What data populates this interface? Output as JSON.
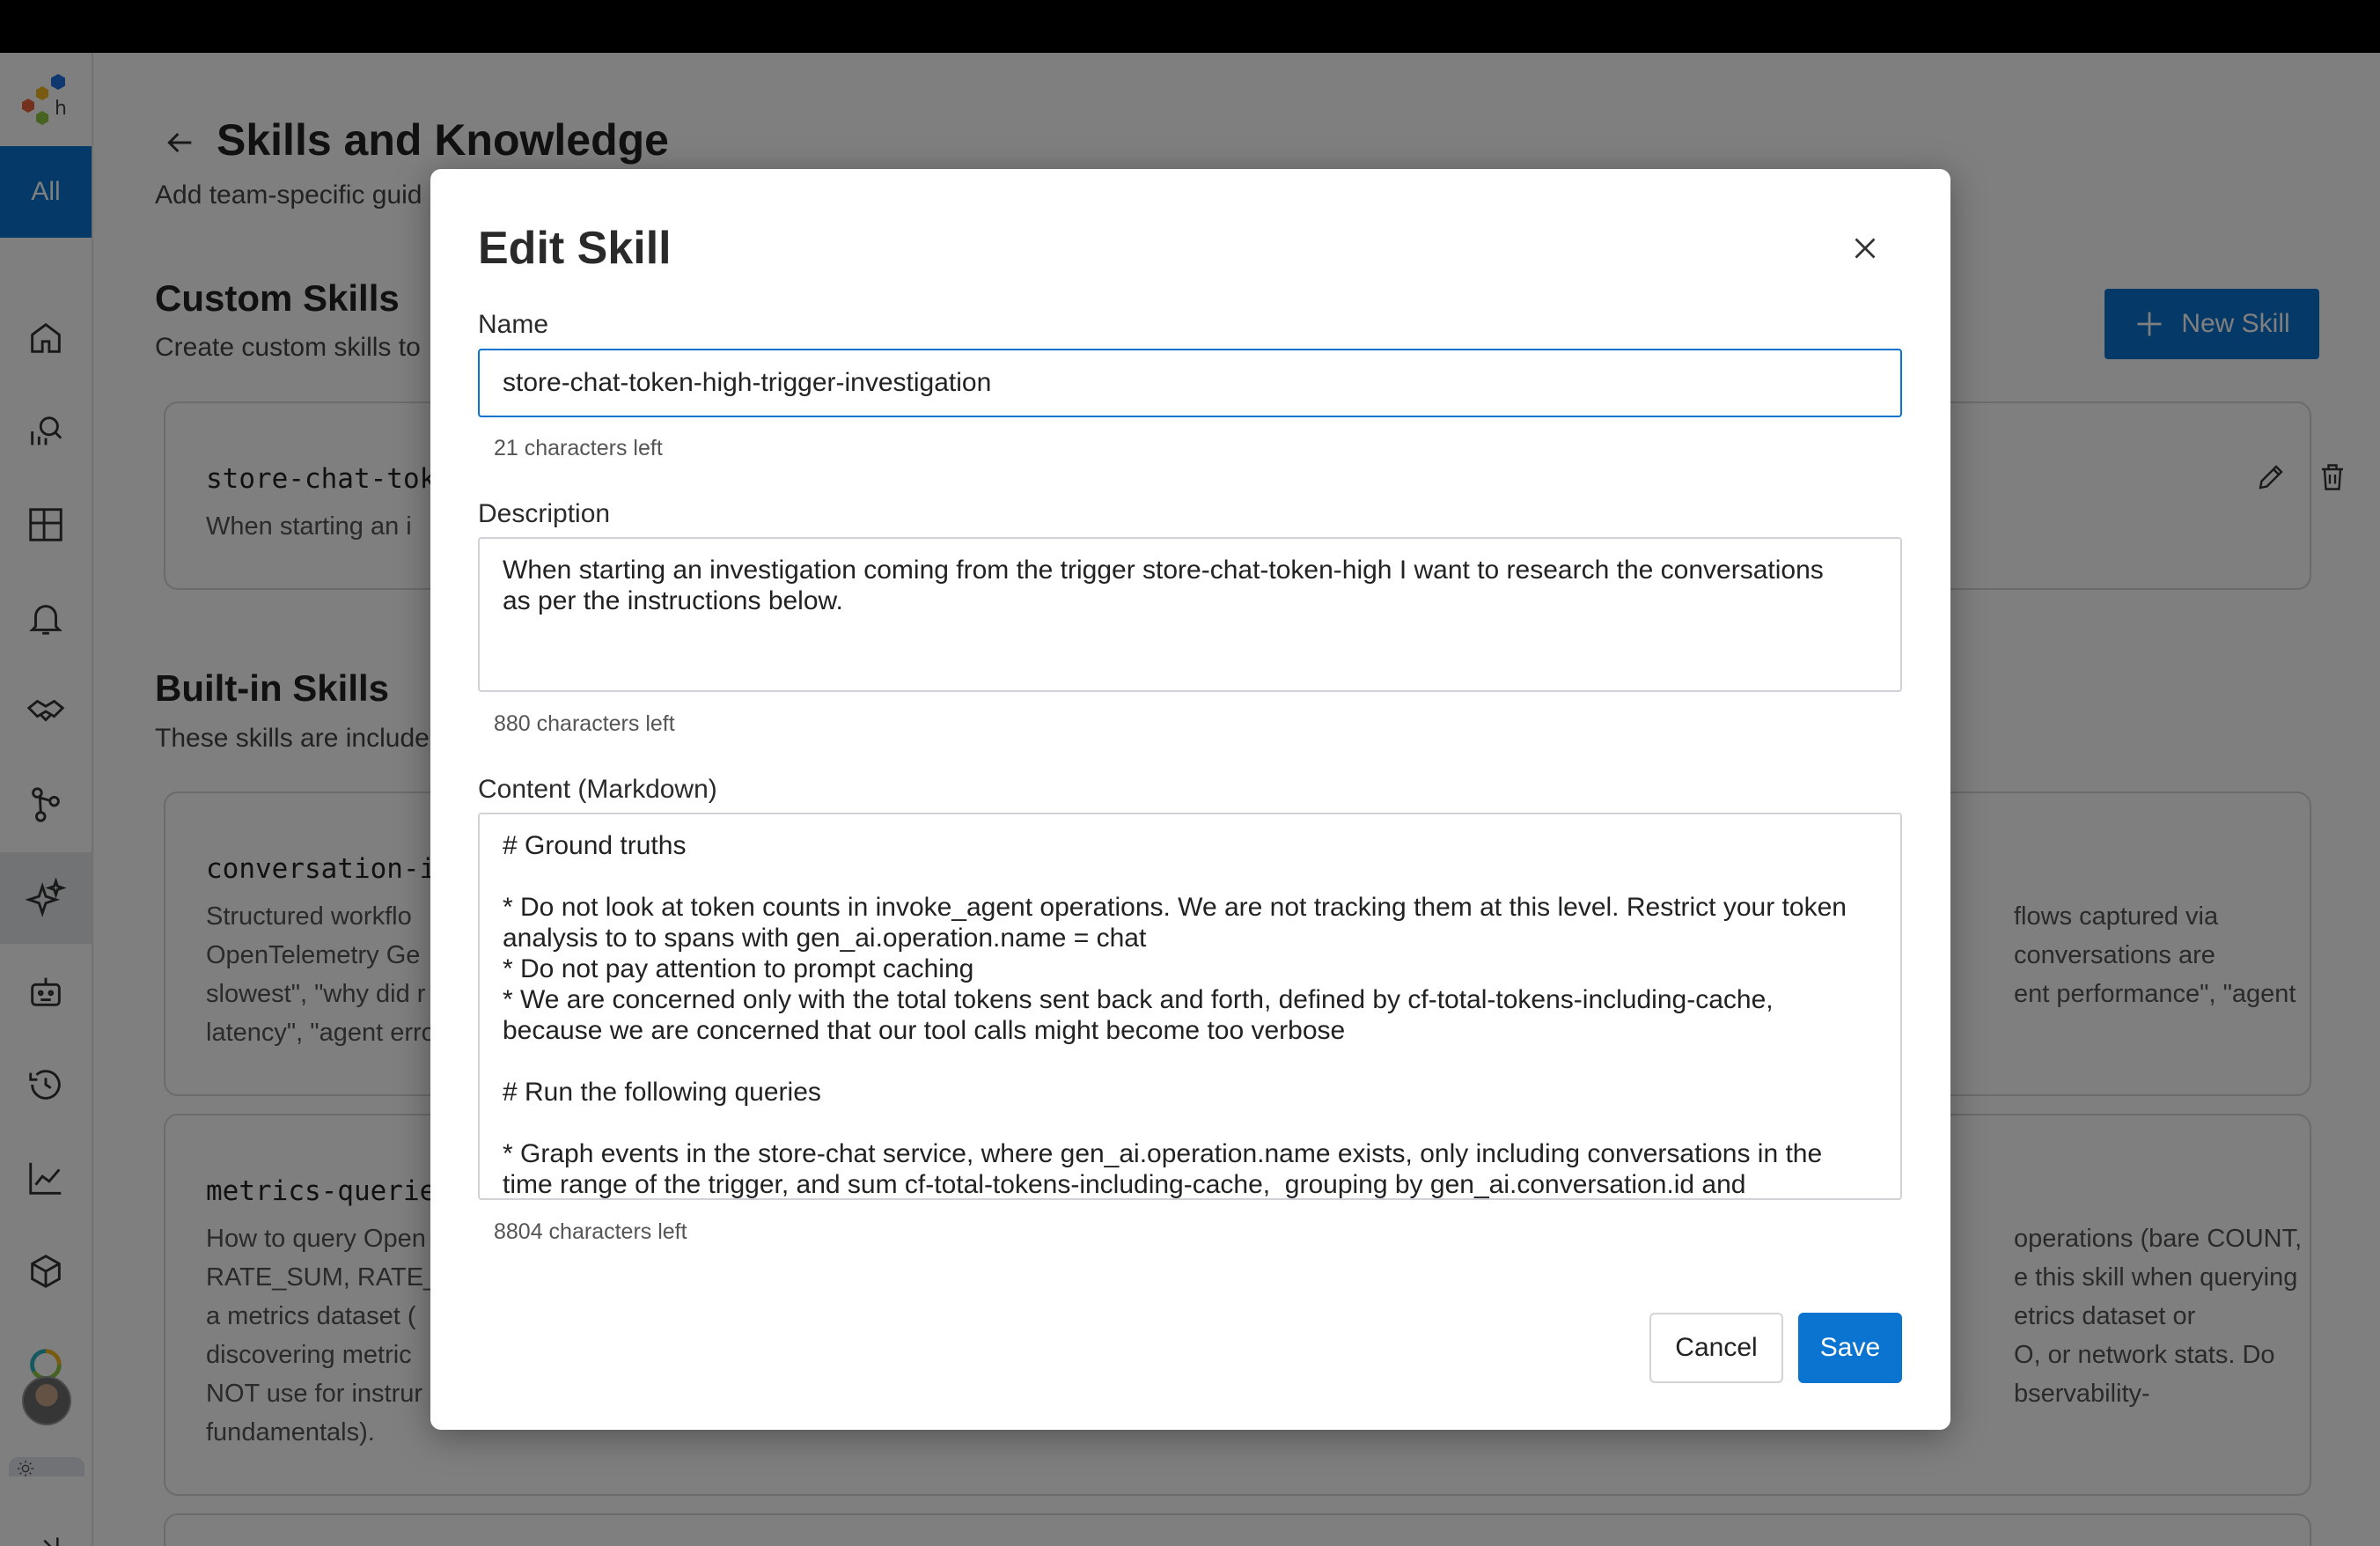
{
  "app": {
    "nav_all_label": "All",
    "accent_color": "#0b74d1"
  },
  "sidebar": {
    "items": [
      {
        "icon": "home-icon"
      },
      {
        "icon": "query-search-icon"
      },
      {
        "icon": "boards-icon"
      },
      {
        "icon": "bell-icon"
      },
      {
        "icon": "handshake-icon"
      },
      {
        "icon": "branch-icon"
      },
      {
        "icon": "sparkles-icon",
        "active": true
      },
      {
        "icon": "robot-icon"
      },
      {
        "icon": "history-icon"
      },
      {
        "icon": "line-chart-icon"
      },
      {
        "icon": "cube-icon"
      },
      {
        "icon": "status-ring-icon"
      }
    ]
  },
  "page": {
    "title": "Skills and Knowledge",
    "subtitle": "Add team-specific guid",
    "custom": {
      "title": "Custom Skills",
      "subtitle": "Create custom skills to",
      "new_skill_label": "New Skill",
      "card": {
        "name": "store-chat-tok",
        "desc": "When starting an i"
      }
    },
    "builtin": {
      "title": "Built-in Skills",
      "subtitle": "These skills are include",
      "cards": [
        {
          "name": "conversation-i",
          "left_lines": [
            "Structured workflo",
            "OpenTelemetry Ge",
            "slowest\", \"why did r",
            "latency\", \"agent erro"
          ],
          "right_lines": [
            "flows captured via",
            "conversations are",
            "ent performance\", \"agent"
          ]
        },
        {
          "name": "metrics-querie",
          "left_lines": [
            "How to query Open",
            "RATE_SUM, RATE_A",
            "a metrics dataset (",
            "discovering metric",
            "NOT use for instrur",
            "fundamentals)."
          ],
          "right_lines": [
            "operations (bare COUNT,",
            "e this skill when querying",
            "etrics dataset or",
            "O, or network stats. Do",
            "bservability-"
          ]
        }
      ]
    }
  },
  "modal": {
    "title": "Edit Skill",
    "name_label": "Name",
    "name_value": "store-chat-token-high-trigger-investigation",
    "name_helper": "21 characters left",
    "description_label": "Description",
    "description_lines": [
      "When starting an investigation coming from the trigger store-chat-token-high I want to research the conversations",
      "as per the instructions below."
    ],
    "description_helper": "880 characters left",
    "content_label": "Content (Markdown)",
    "content_lines": [
      "# Ground truths",
      "",
      "* Do not look at token counts in invoke_agent operations. We are not tracking them at this level. Restrict your token",
      "analysis to to spans with gen_ai.operation.name = chat",
      "* Do not pay attention to prompt caching",
      "* We are concerned only with the total tokens sent back and forth, defined by cf-total-tokens-including-cache,",
      "because we are concerned that our tool calls might become too verbose",
      "",
      "# Run the following queries",
      "",
      "* Graph events in the store-chat service, where gen_ai.operation.name exists, only including conversations in the",
      "time range of the trigger, and sum cf-total-tokens-including-cache,  grouping by gen_ai.conversation.id and"
    ],
    "content_helper": "8804 characters left",
    "cancel_label": "Cancel",
    "save_label": "Save"
  }
}
